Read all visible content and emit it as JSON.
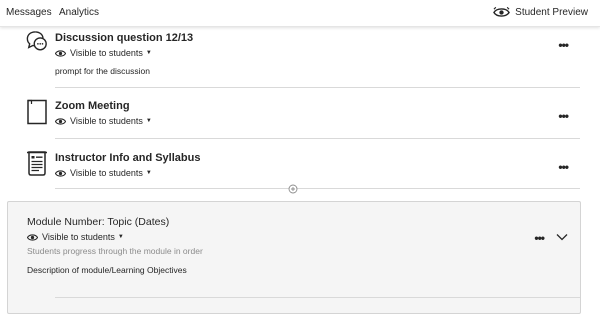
{
  "top_nav": {
    "tabs": [
      {
        "label": "Messages"
      },
      {
        "label": "Analytics"
      }
    ],
    "student_preview_label": "Student Preview"
  },
  "items": [
    {
      "title": "Discussion question 12/13",
      "visibility": "Visible to students",
      "description": "prompt for the discussion",
      "icon": "discussion-icon"
    },
    {
      "title": "Zoom Meeting",
      "visibility": "Visible to students",
      "icon": "document-icon"
    },
    {
      "title": "Instructor Info and Syllabus",
      "visibility": "Visible to students",
      "icon": "syllabus-icon"
    }
  ],
  "module": {
    "title": "Module Number: Topic (Dates)",
    "visibility": "Visible to students",
    "sequence_note": "Students progress through the module in order",
    "description": "Description of module/Learning Objectives"
  },
  "colors": {
    "text": "#262626",
    "muted": "#8c8c8c",
    "module_background": "#f5f5f5",
    "divider": "#d9d9d9"
  }
}
